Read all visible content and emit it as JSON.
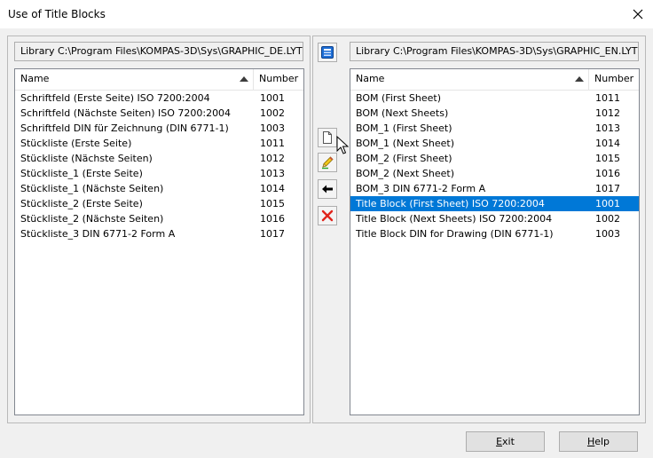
{
  "window": {
    "title": "Use of Title Blocks"
  },
  "left": {
    "library_label": "Library C:\\Program Files\\KOMPAS-3D\\Sys\\GRAPHIC_DE.LYT",
    "columns": {
      "name": "Name",
      "number": "Number"
    },
    "rows": [
      {
        "name": "Schriftfeld (Erste Seite) ISO 7200:2004",
        "number": "1001"
      },
      {
        "name": "Schriftfeld (Nächste Seiten) ISO 7200:2004",
        "number": "1002"
      },
      {
        "name": "Schriftfeld DIN für Zeichnung (DIN 6771-1)",
        "number": "1003"
      },
      {
        "name": "Stückliste (Erste Seite)",
        "number": "1011"
      },
      {
        "name": "Stückliste (Nächste Seiten)",
        "number": "1012"
      },
      {
        "name": "Stückliste_1 (Erste Seite)",
        "number": "1013"
      },
      {
        "name": "Stückliste_1 (Nächste Seiten)",
        "number": "1014"
      },
      {
        "name": "Stückliste_2 (Erste Seite)",
        "number": "1015"
      },
      {
        "name": "Stückliste_2 (Nächste Seiten)",
        "number": "1016"
      },
      {
        "name": "Stückliste_3 DIN 6771-2 Form A",
        "number": "1017"
      }
    ]
  },
  "right": {
    "library_label": "Library C:\\Program Files\\KOMPAS-3D\\Sys\\GRAPHIC_EN.LYT",
    "columns": {
      "name": "Name",
      "number": "Number"
    },
    "selected_index": 7,
    "rows": [
      {
        "name": "BOM (First Sheet)",
        "number": "1011"
      },
      {
        "name": "BOM (Next Sheets)",
        "number": "1012"
      },
      {
        "name": "BOM_1 (First Sheet)",
        "number": "1013"
      },
      {
        "name": "BOM_1 (Next Sheet)",
        "number": "1014"
      },
      {
        "name": "BOM_2 (First Sheet)",
        "number": "1015"
      },
      {
        "name": "BOM_2 (Next Sheet)",
        "number": "1016"
      },
      {
        "name": "BOM_3 DIN 6771-2 Form A",
        "number": "1017"
      },
      {
        "name": "Title Block (First Sheet) ISO 7200:2004",
        "number": "1001"
      },
      {
        "name": "Title Block (Next Sheets) ISO 7200:2004",
        "number": "1002"
      },
      {
        "name": "Title Block DIN for Drawing (DIN 6771-1)",
        "number": "1003"
      }
    ]
  },
  "toolbar": {
    "icons": [
      "library-icon",
      "new-document-icon",
      "edit-pencil-icon",
      "arrow-left-icon",
      "delete-x-icon"
    ]
  },
  "footer": {
    "exit": {
      "pre": "",
      "accel": "E",
      "post": "xit"
    },
    "help": {
      "pre": "",
      "accel": "H",
      "post": "elp"
    }
  },
  "colors": {
    "selection": "#0078d7",
    "delete": "#e0241b",
    "accent_blue": "#1e6fd6"
  }
}
